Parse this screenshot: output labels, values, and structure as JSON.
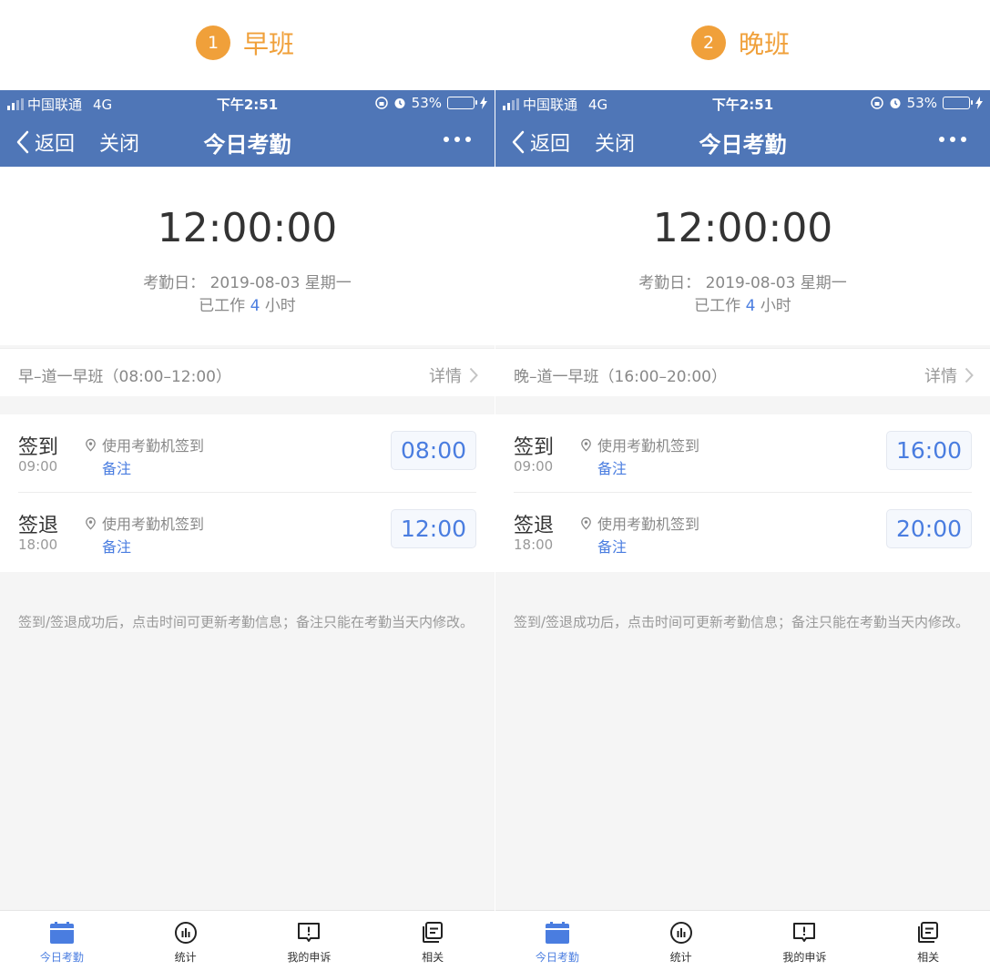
{
  "labels": [
    {
      "number": "1",
      "text": "早班"
    },
    {
      "number": "2",
      "text": "晚班"
    }
  ],
  "colors": {
    "accent": "#f0a03a",
    "nav": "#4f76b7",
    "link": "#4a7de0",
    "battery": "#5fd35a"
  },
  "phones": [
    {
      "status": {
        "carrier": "中国联通",
        "network": "4G",
        "time": "下午2:51",
        "battery": "53%"
      },
      "nav": {
        "back": "返回",
        "close": "关闭",
        "title": "今日考勤"
      },
      "clock": "12:00:00",
      "date_label": "考勤日：",
      "date_value": "2019-08-03 星期一",
      "worked_prefix": "已工作",
      "worked_hours": "4",
      "worked_suffix": "小时",
      "shift": {
        "name": "早–道一早班（08:00–12:00）",
        "detail": "详情"
      },
      "records": [
        {
          "label": "签到",
          "scheduled": "09:00",
          "method": "使用考勤机签到",
          "note": "备注",
          "time": "08:00"
        },
        {
          "label": "签退",
          "scheduled": "18:00",
          "method": "使用考勤机签到",
          "note": "备注",
          "time": "12:00"
        }
      ],
      "tip": "签到/签退成功后，点击时间可更新考勤信息；备注只能在考勤当天内修改。",
      "tabs": [
        {
          "label": "今日考勤",
          "icon": "calendar-icon"
        },
        {
          "label": "统计",
          "icon": "stats-icon"
        },
        {
          "label": "我的申诉",
          "icon": "appeal-icon"
        },
        {
          "label": "相关",
          "icon": "related-icon"
        }
      ]
    },
    {
      "status": {
        "carrier": "中国联通",
        "network": "4G",
        "time": "下午2:51",
        "battery": "53%"
      },
      "nav": {
        "back": "返回",
        "close": "关闭",
        "title": "今日考勤"
      },
      "clock": "12:00:00",
      "date_label": "考勤日：",
      "date_value": "2019-08-03 星期一",
      "worked_prefix": "已工作",
      "worked_hours": "4",
      "worked_suffix": "小时",
      "shift": {
        "name": "晚–道一早班（16:00–20:00）",
        "detail": "详情"
      },
      "records": [
        {
          "label": "签到",
          "scheduled": "09:00",
          "method": "使用考勤机签到",
          "note": "备注",
          "time": "16:00"
        },
        {
          "label": "签退",
          "scheduled": "18:00",
          "method": "使用考勤机签到",
          "note": "备注",
          "time": "20:00"
        }
      ],
      "tip": "签到/签退成功后，点击时间可更新考勤信息；备注只能在考勤当天内修改。",
      "tabs": [
        {
          "label": "今日考勤",
          "icon": "calendar-icon"
        },
        {
          "label": "统计",
          "icon": "stats-icon"
        },
        {
          "label": "我的申诉",
          "icon": "appeal-icon"
        },
        {
          "label": "相关",
          "icon": "related-icon"
        }
      ]
    }
  ]
}
